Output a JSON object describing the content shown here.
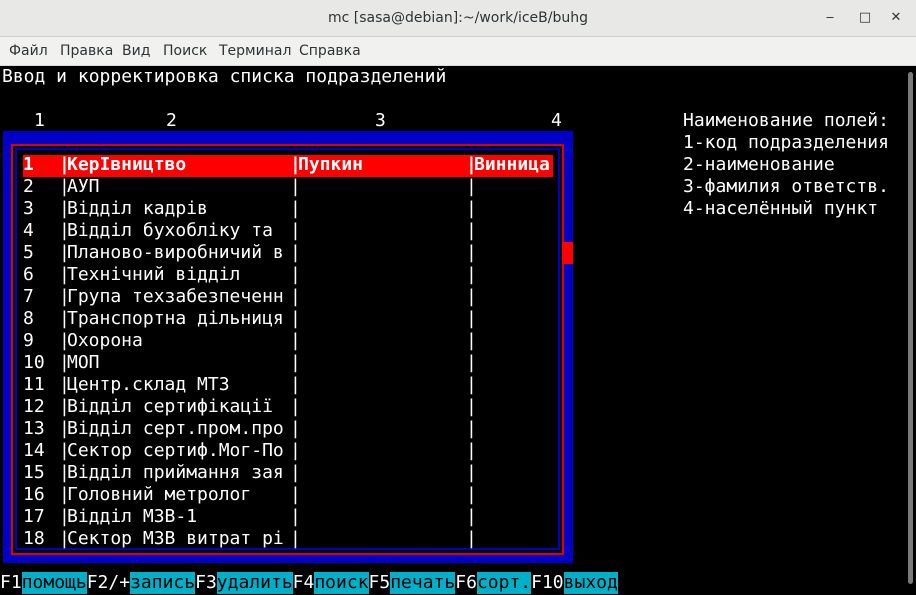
{
  "window": {
    "title": "mc [sasa@debian]:~/work/iceB/buhg",
    "minimize": "‒",
    "maximize": "□",
    "close": "✕"
  },
  "menu": [
    "Файл",
    "Правка",
    "Вид",
    "Поиск",
    "Терминал",
    "Справка"
  ],
  "screen": {
    "heading": "Ввод и корректировка списка подразделений",
    "col_numbers": [
      "1",
      "2",
      "3",
      "4"
    ],
    "legend_title": "Наименование полей:",
    "legend": [
      "1-код подразделения",
      "2-наименование",
      "3-фамилия ответств.",
      "4-населённый пункт"
    ]
  },
  "rows": [
    {
      "code": "1",
      "name": "КерIвництво",
      "resp": "Пупкин",
      "place": "Винница"
    },
    {
      "code": "2",
      "name": "АУП",
      "resp": "",
      "place": ""
    },
    {
      "code": "3",
      "name": "Відділ кадрів",
      "resp": "",
      "place": ""
    },
    {
      "code": "4",
      "name": "Відділ бухобліку та ",
      "resp": "",
      "place": ""
    },
    {
      "code": "5",
      "name": "Планово-виробничий в",
      "resp": "",
      "place": ""
    },
    {
      "code": "6",
      "name": "Технічний відділ",
      "resp": "",
      "place": ""
    },
    {
      "code": "7",
      "name": "Група техзабезпеченн",
      "resp": "",
      "place": ""
    },
    {
      "code": "8",
      "name": "Транспортна дільниця",
      "resp": "",
      "place": ""
    },
    {
      "code": "9",
      "name": "Охорона",
      "resp": "",
      "place": ""
    },
    {
      "code": "10",
      "name": "МОП",
      "resp": "",
      "place": ""
    },
    {
      "code": "11",
      "name": "Центр.склад МТЗ",
      "resp": "",
      "place": ""
    },
    {
      "code": "12",
      "name": "Відділ сертифікації ",
      "resp": "",
      "place": ""
    },
    {
      "code": "13",
      "name": "Відділ серт.пром.про",
      "resp": "",
      "place": ""
    },
    {
      "code": "14",
      "name": "Сектор сертиф.Мог-По",
      "resp": "",
      "place": ""
    },
    {
      "code": "15",
      "name": "Відділ приймання зая",
      "resp": "",
      "place": ""
    },
    {
      "code": "16",
      "name": "Головний метролог",
      "resp": "",
      "place": ""
    },
    {
      "code": "17",
      "name": "Відділ МЗВ-1",
      "resp": "",
      "place": ""
    },
    {
      "code": "18",
      "name": "Сектор МЗВ витрат рі",
      "resp": "",
      "place": ""
    }
  ],
  "fkeys": [
    {
      "key": "F1",
      "label": "помощь"
    },
    {
      "key": "F2/+",
      "label": "запись"
    },
    {
      "key": "F3",
      "label": "удалить"
    },
    {
      "key": "F4",
      "label": "поиск"
    },
    {
      "key": "F5",
      "label": "печать"
    },
    {
      "key": "F6",
      "label": "сорт."
    },
    {
      "key": "F10",
      "label": "выход"
    }
  ]
}
